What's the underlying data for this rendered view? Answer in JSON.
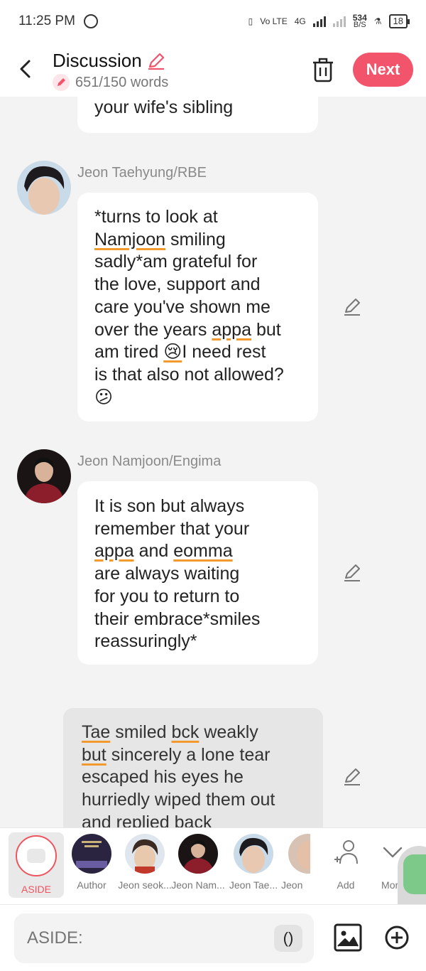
{
  "status_bar": {
    "time": "11:25 PM",
    "net_label": "Vo LTE",
    "net_type": "4G",
    "speed_value": "534",
    "speed_unit": "B/S",
    "battery": "18"
  },
  "header": {
    "title": "Discussion",
    "word_count": "651/150 words",
    "next_label": "Next"
  },
  "messages": {
    "partial_top": {
      "line": "your wife's sibling"
    },
    "m1": {
      "name": "Jeon Taehyung/RBE",
      "lines": [
        "*turns to look at",
        "smiling",
        "sadly*am grateful for",
        "the love, support and",
        "care you've shown me",
        "over the years",
        "but",
        "am tired",
        "I need rest",
        "is that also not allowed?"
      ],
      "underlined": [
        "Namjoon",
        "appa"
      ],
      "emoji_cry": "😢",
      "emoji_confused": "😕"
    },
    "m2": {
      "name": "Jeon Namjoon/Engima",
      "lines": [
        "It is son but always",
        "remember that your",
        "and",
        "are always waiting",
        "for you to return to",
        "their embrace*smiles",
        "reassuringly*"
      ],
      "underlined": [
        "appa",
        "eomma"
      ]
    },
    "aside": {
      "lines": [
        "smiled",
        "weakly",
        "sincerely a lone tear",
        "escaped his eyes he",
        "hurriedly wiped them out",
        "and replied back"
      ],
      "underlined": [
        "Tae",
        "bck",
        "but"
      ]
    }
  },
  "characters": {
    "aside": "ASIDE",
    "author": "Author",
    "c1": "Jeon seok...",
    "c2": "Jeon Nam...",
    "c3": "Jeon Tae...",
    "c4": "Jeon",
    "add": "Add",
    "more": "More"
  },
  "input": {
    "placeholder": "ASIDE:",
    "paren": "()"
  },
  "colors": {
    "accent": "#f2546b",
    "underline": "#f39a2e"
  }
}
